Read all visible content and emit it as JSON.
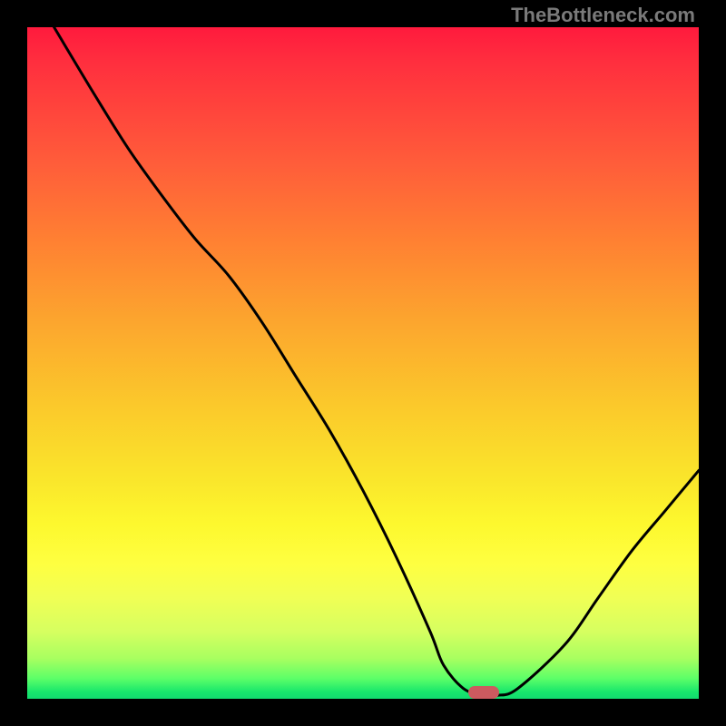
{
  "watermark": "TheBottleneck.com",
  "colors": {
    "background": "#000000",
    "gradient_top": "#FF1A3D",
    "gradient_mid": "#FBC82B",
    "gradient_bottom": "#12DA6F",
    "curve": "#000000",
    "marker": "#CC5A5F"
  },
  "chart_data": {
    "type": "line",
    "title": "",
    "xlabel": "",
    "ylabel": "",
    "xlim": [
      0,
      100
    ],
    "ylim": [
      0,
      100
    ],
    "series": [
      {
        "name": "curve",
        "x": [
          4,
          10,
          15,
          20,
          25,
          30,
          35,
          40,
          45,
          50,
          55,
          60,
          62,
          65,
          68,
          70,
          73,
          80,
          85,
          90,
          95,
          100
        ],
        "values": [
          100,
          90,
          82,
          75,
          68.5,
          63,
          56,
          48,
          40,
          31,
          21,
          10,
          5,
          1.5,
          0.5,
          0.5,
          1.5,
          8,
          15,
          22,
          28,
          34
        ]
      }
    ],
    "marker": {
      "x": 68,
      "y": 1.0
    },
    "grid": false,
    "legend_position": "none"
  }
}
